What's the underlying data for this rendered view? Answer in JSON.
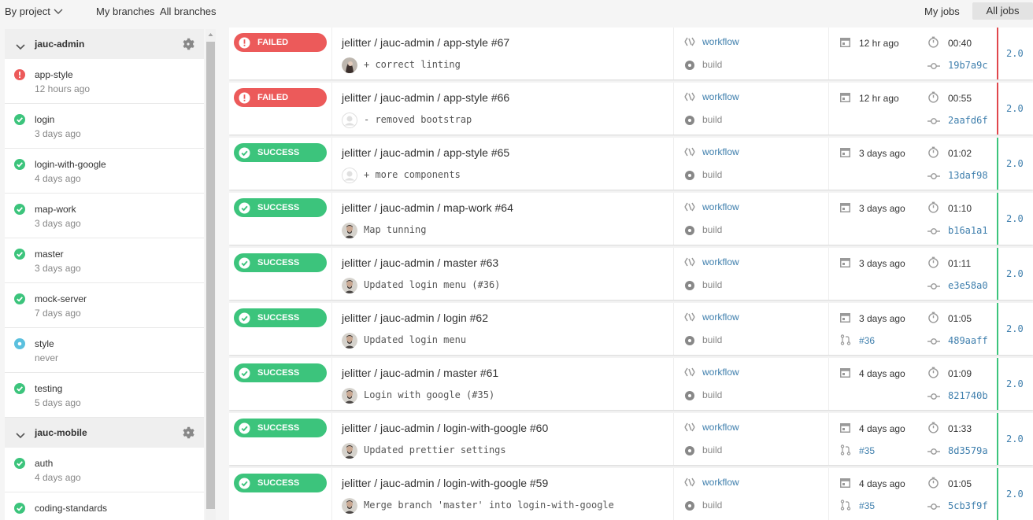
{
  "topbar": {
    "by_project": "By project",
    "my_branches": "My branches",
    "all_branches": "All branches",
    "my_jobs": "My jobs",
    "all_jobs": "All jobs"
  },
  "colors": {
    "success": "#3cc47c",
    "failed": "#ec5a5a",
    "running": "#5bc0de",
    "link": "#3f7fad"
  },
  "sidebar": {
    "projects": [
      {
        "name": "jauc-admin",
        "branches": [
          {
            "name": "app-style",
            "time": "12 hours ago",
            "status": "failed"
          },
          {
            "name": "login",
            "time": "3 days ago",
            "status": "success"
          },
          {
            "name": "login-with-google",
            "time": "4 days ago",
            "status": "success"
          },
          {
            "name": "map-work",
            "time": "3 days ago",
            "status": "success"
          },
          {
            "name": "master",
            "time": "3 days ago",
            "status": "success"
          },
          {
            "name": "mock-server",
            "time": "7 days ago",
            "status": "success"
          },
          {
            "name": "style",
            "time": "never",
            "status": "none"
          },
          {
            "name": "testing",
            "time": "5 days ago",
            "status": "success"
          }
        ]
      },
      {
        "name": "jauc-mobile",
        "branches": [
          {
            "name": "auth",
            "time": "4 days ago",
            "status": "success"
          },
          {
            "name": "coding-standards",
            "time": "",
            "status": "success"
          }
        ]
      }
    ]
  },
  "jobs": [
    {
      "status": "failed",
      "status_label": "FAILED",
      "title": "jelitter / jauc-admin / app-style #67",
      "commit": "+ correct linting",
      "avatar": "photo-dark",
      "workflow": "workflow",
      "step": "build",
      "ago": "12 hr ago",
      "duration": "00:40",
      "pr": "",
      "sha": "19b7a9c",
      "version": "2.0"
    },
    {
      "status": "failed",
      "status_label": "FAILED",
      "title": "jelitter / jauc-admin / app-style #66",
      "commit": "- removed bootstrap",
      "avatar": "placeholder",
      "workflow": "workflow",
      "step": "build",
      "ago": "12 hr ago",
      "duration": "00:55",
      "pr": "",
      "sha": "2aafd6f",
      "version": "2.0"
    },
    {
      "status": "success",
      "status_label": "SUCCESS",
      "title": "jelitter / jauc-admin / app-style #65",
      "commit": "+ more components",
      "avatar": "placeholder",
      "workflow": "workflow",
      "step": "build",
      "ago": "3 days ago",
      "duration": "01:02",
      "pr": "",
      "sha": "13daf98",
      "version": "2.0"
    },
    {
      "status": "success",
      "status_label": "SUCCESS",
      "title": "jelitter / jauc-admin / map-work #64",
      "commit": "Map tunning",
      "avatar": "photo",
      "workflow": "workflow",
      "step": "build",
      "ago": "3 days ago",
      "duration": "01:10",
      "pr": "",
      "sha": "b16a1a1",
      "version": "2.0"
    },
    {
      "status": "success",
      "status_label": "SUCCESS",
      "title": "jelitter / jauc-admin / master #63",
      "commit": "Updated login menu (#36)",
      "avatar": "photo",
      "workflow": "workflow",
      "step": "build",
      "ago": "3 days ago",
      "duration": "01:11",
      "pr": "",
      "sha": "e3e58a0",
      "version": "2.0"
    },
    {
      "status": "success",
      "status_label": "SUCCESS",
      "title": "jelitter / jauc-admin / login #62",
      "commit": "Updated login menu",
      "avatar": "photo",
      "workflow": "workflow",
      "step": "build",
      "ago": "3 days ago",
      "duration": "01:05",
      "pr": "#36",
      "sha": "489aaff",
      "version": "2.0"
    },
    {
      "status": "success",
      "status_label": "SUCCESS",
      "title": "jelitter / jauc-admin / master #61",
      "commit": "Login with google (#35)",
      "avatar": "photo",
      "workflow": "workflow",
      "step": "build",
      "ago": "4 days ago",
      "duration": "01:09",
      "pr": "",
      "sha": "821740b",
      "version": "2.0"
    },
    {
      "status": "success",
      "status_label": "SUCCESS",
      "title": "jelitter / jauc-admin / login-with-google #60",
      "commit": "Updated prettier settings",
      "avatar": "photo",
      "workflow": "workflow",
      "step": "build",
      "ago": "4 days ago",
      "duration": "01:33",
      "pr": "#35",
      "sha": "8d3579a",
      "version": "2.0"
    },
    {
      "status": "success",
      "status_label": "SUCCESS",
      "title": "jelitter / jauc-admin / login-with-google #59",
      "commit": "Merge branch 'master' into login-with-google",
      "avatar": "photo",
      "workflow": "workflow",
      "step": "build",
      "ago": "4 days ago",
      "duration": "01:05",
      "pr": "#35",
      "sha": "5cb3f9f",
      "version": "2.0"
    }
  ]
}
